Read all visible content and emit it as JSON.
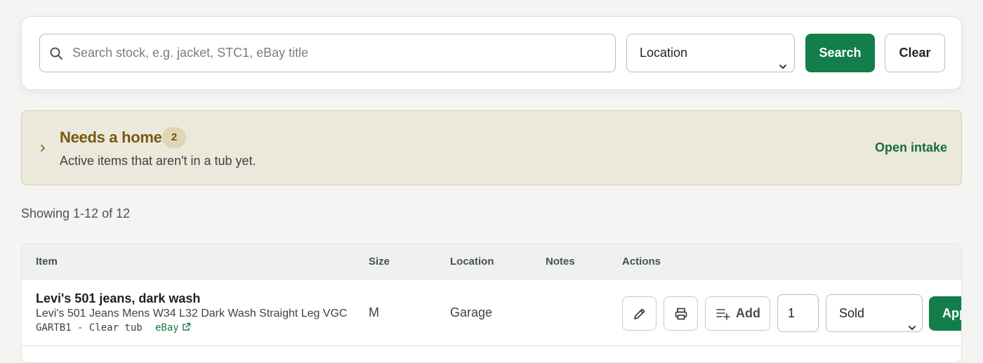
{
  "search": {
    "placeholder": "Search stock, e.g. jacket, STC1, eBay title",
    "value": "",
    "location_selected": "Location",
    "search_label": "Search",
    "clear_label": "Clear"
  },
  "needs_home": {
    "title": "Needs a home",
    "count": "2",
    "subtitle": "Active items that aren't in a tub yet.",
    "action_label": "Open intake"
  },
  "results": {
    "showing_text": "Showing 1-12 of 12"
  },
  "table": {
    "columns": [
      "Item",
      "Size",
      "Location",
      "Notes",
      "Actions"
    ],
    "rows": [
      {
        "title": "Levi's 501 jeans, dark wash",
        "description": "Levi's 501 Jeans Mens W34 L32 Dark Wash Straight Leg VGC",
        "code": "GARTB1 - Clear tub",
        "link_label": "eBay",
        "size": "M",
        "location": "Garage",
        "notes": "",
        "add_label": "Add",
        "quantity": "1",
        "status_selected": "Sold",
        "apply_label": "Apply"
      }
    ]
  },
  "colors": {
    "primary": "#137e4a",
    "banner_bg": "#ebe9dc",
    "banner_title": "#7a5712",
    "link": "#177a48"
  },
  "icons": {
    "search": "search-icon",
    "location_chevron": "chevron-down-icon",
    "expand": "chevron-right-icon",
    "edit": "pencil-icon",
    "print": "printer-icon",
    "add_list": "list-add-icon",
    "external": "external-link-icon"
  }
}
